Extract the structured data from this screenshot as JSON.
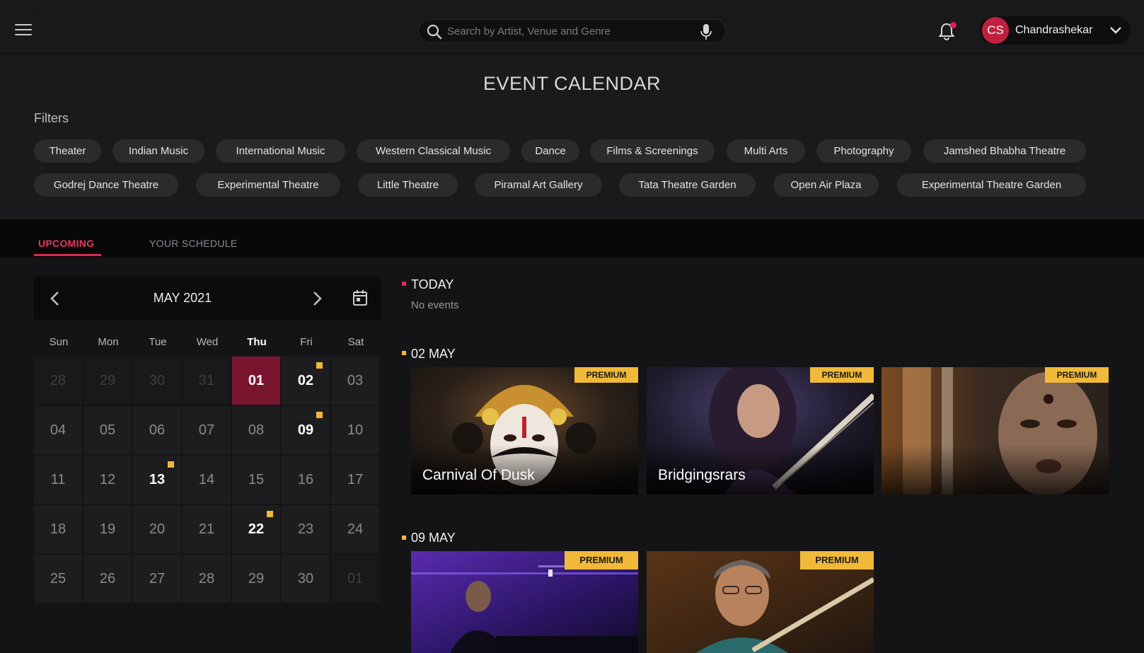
{
  "header": {
    "search_placeholder": "Search by Artist, Venue and Genre",
    "user_initials": "CS",
    "user_name": "Chandrashekar",
    "accent_color": "#c0203f",
    "icons": [
      "menu-icon",
      "search-icon",
      "mic-icon",
      "bell-icon",
      "chevron-down-icon"
    ]
  },
  "page": {
    "title": "EVENT CALENDAR",
    "filters_label": "Filters"
  },
  "filters": [
    "Theater",
    "Indian Music",
    "International Music",
    "Western Classical Music",
    "Dance",
    "Films & Screenings",
    "Multi Arts",
    "Photography",
    "Jamshed Bhabha Theatre",
    "Godrej Dance Theatre",
    "Experimental Theatre",
    "Little Theatre",
    "Piramal Art Gallery",
    "Tata Theatre Garden",
    "Open Air Plaza",
    "Experimental Theatre Garden"
  ],
  "tabs": {
    "upcoming": "UPCOMING",
    "schedule": "YOUR SCHEDULE",
    "active": "upcoming"
  },
  "calendar": {
    "month_label": "MAY 2021",
    "weekdays": [
      "Sun",
      "Mon",
      "Tue",
      "Wed",
      "Thu",
      "Fri",
      "Sat"
    ],
    "highlight_weekday": "Thu",
    "days": [
      {
        "label": "28",
        "state": "other"
      },
      {
        "label": "29",
        "state": "other"
      },
      {
        "label": "30",
        "state": "other"
      },
      {
        "label": "31",
        "state": "other"
      },
      {
        "label": "01",
        "state": "today"
      },
      {
        "label": "02",
        "state": "event"
      },
      {
        "label": "03",
        "state": "normal"
      },
      {
        "label": "04",
        "state": "normal"
      },
      {
        "label": "05",
        "state": "normal"
      },
      {
        "label": "06",
        "state": "normal"
      },
      {
        "label": "07",
        "state": "normal"
      },
      {
        "label": "08",
        "state": "normal"
      },
      {
        "label": "09",
        "state": "event"
      },
      {
        "label": "10",
        "state": "normal"
      },
      {
        "label": "11",
        "state": "normal"
      },
      {
        "label": "12",
        "state": "normal"
      },
      {
        "label": "13",
        "state": "event"
      },
      {
        "label": "14",
        "state": "normal"
      },
      {
        "label": "15",
        "state": "normal"
      },
      {
        "label": "16",
        "state": "normal"
      },
      {
        "label": "17",
        "state": "normal"
      },
      {
        "label": "18",
        "state": "normal"
      },
      {
        "label": "19",
        "state": "normal"
      },
      {
        "label": "20",
        "state": "normal"
      },
      {
        "label": "21",
        "state": "normal"
      },
      {
        "label": "22",
        "state": "event"
      },
      {
        "label": "23",
        "state": "normal"
      },
      {
        "label": "24",
        "state": "normal"
      },
      {
        "label": "25",
        "state": "normal"
      },
      {
        "label": "26",
        "state": "normal"
      },
      {
        "label": "27",
        "state": "normal"
      },
      {
        "label": "28",
        "state": "normal"
      },
      {
        "label": "29",
        "state": "normal"
      },
      {
        "label": "30",
        "state": "normal"
      },
      {
        "label": "01",
        "state": "other"
      }
    ],
    "event_marker_color": "#f0b93a",
    "today_color": "#7a1530"
  },
  "sections": {
    "today": {
      "title": "TODAY",
      "empty_text": "No events",
      "marker_color": "#e0284e"
    },
    "may02": {
      "title": "02 MAY",
      "marker_color": "#f0b93a"
    },
    "may09": {
      "title": "09 MAY",
      "marker_color": "#f0b93a"
    }
  },
  "events": {
    "may02": [
      {
        "title": "Carnival Of Dusk",
        "badge": "PREMIUM"
      },
      {
        "title": "Bridgingsrars",
        "badge": "PREMIUM"
      },
      {
        "title": "",
        "badge": "PREMIUM"
      }
    ],
    "may09": [
      {
        "title": "",
        "badge": "PREMIUM"
      },
      {
        "title": "",
        "badge": "PREMIUM"
      }
    ]
  }
}
